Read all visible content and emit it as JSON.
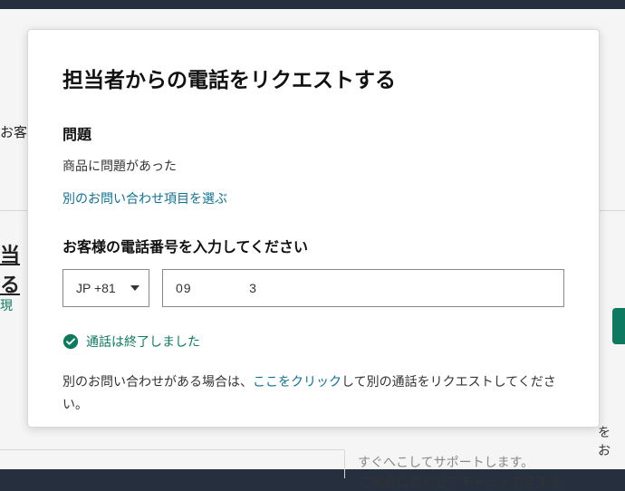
{
  "background": {
    "left1": "お客",
    "left2_line1": "当",
    "left2_line2": "る",
    "left3": "現",
    "right1": "を",
    "right1b": "お",
    "right2": "すぐへこしてサポートします。",
    "right3": "ご都合に合わせてチャットできます。"
  },
  "modal": {
    "title": "担当者からの電話をリクエストする",
    "issue_heading": "問題",
    "issue_text": "商品に問題があった",
    "change_issue_link": "別のお問い合わせ項目を選ぶ",
    "phone_heading": "お客様の電話番号を入力してください",
    "country_code": "JP +81",
    "phone_value": "09             3",
    "status_text": "通話は終了しました",
    "help_prefix": "別のお問い合わせがある場合は、",
    "help_link": "ここをクリック",
    "help_suffix": "して別の通話をリクエストしてください。"
  }
}
